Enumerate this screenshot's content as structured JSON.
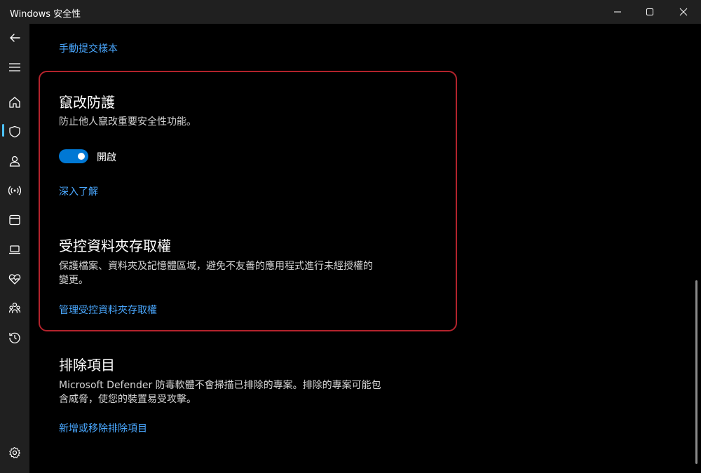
{
  "window": {
    "title": "Windows 安全性",
    "controls": [
      "minimize-icon",
      "maximize-icon",
      "close-icon"
    ]
  },
  "sidebar": {
    "items": [
      {
        "name": "back",
        "icon": "back-arrow-icon"
      },
      {
        "name": "menu",
        "icon": "hamburger-icon"
      },
      {
        "name": "home",
        "icon": "home-icon"
      },
      {
        "name": "virus-protection",
        "icon": "shield-icon",
        "active": true
      },
      {
        "name": "account-protection",
        "icon": "person-icon"
      },
      {
        "name": "firewall-network",
        "icon": "wireless-icon"
      },
      {
        "name": "app-browser-control",
        "icon": "app-window-icon"
      },
      {
        "name": "device-security",
        "icon": "laptop-icon"
      },
      {
        "name": "device-performance",
        "icon": "heart-pulse-icon"
      },
      {
        "name": "family-options",
        "icon": "family-icon"
      },
      {
        "name": "protection-history",
        "icon": "history-icon"
      },
      {
        "name": "settings",
        "icon": "gear-icon"
      }
    ]
  },
  "main": {
    "submit_sample_link": "手動提交樣本",
    "tamper": {
      "title": "竄改防護",
      "description": "防止他人竄改重要安全性功能。",
      "toggle_state": "開啟",
      "toggle_on": true,
      "learn_more_link": "深入了解"
    },
    "controlled_folder": {
      "title": "受控資料夾存取權",
      "description_line1": "保護檔案、資料夾及記憶體區域，避免不友善的應用程式進行未經授權的",
      "description_line2": "變更。",
      "manage_link": "管理受控資料夾存取權"
    },
    "exclusions": {
      "title": "排除項目",
      "description_line1": "Microsoft Defender 防毒軟體不會掃描已排除的專案。排除的專案可能包",
      "description_line2": "含威脅，使您的裝置易受攻擊。",
      "add_remove_link": "新增或移除排除項目"
    }
  },
  "colors": {
    "accent": "#0078d4",
    "link": "#4aa8ff",
    "highlight_border": "#b3232c",
    "active_indicator": "#4cc2ff"
  }
}
